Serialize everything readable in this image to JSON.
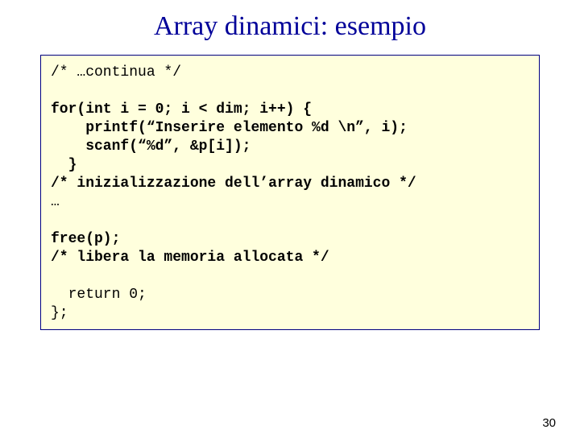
{
  "title": "Array dinamici: esempio",
  "code": {
    "l1": "/* …continua */",
    "l2": "",
    "l3a": "for(int i = 0; i < dim; i++) {",
    "l4a": "    printf(“Inserire elemento %d \\n”, i);",
    "l5a": "    scanf(“%d”, &p[i]);",
    "l6a": "  }",
    "l7a": "/* inizializzazione dell",
    "l7b": "’",
    "l7c": "array dinamico */",
    "l8": "…",
    "l9": "",
    "l10a": "free(p);",
    "l11a": "/* libera la memoria allocata */",
    "l12": "",
    "l13": "  return 0;",
    "l14": "};"
  },
  "page_number": "30"
}
